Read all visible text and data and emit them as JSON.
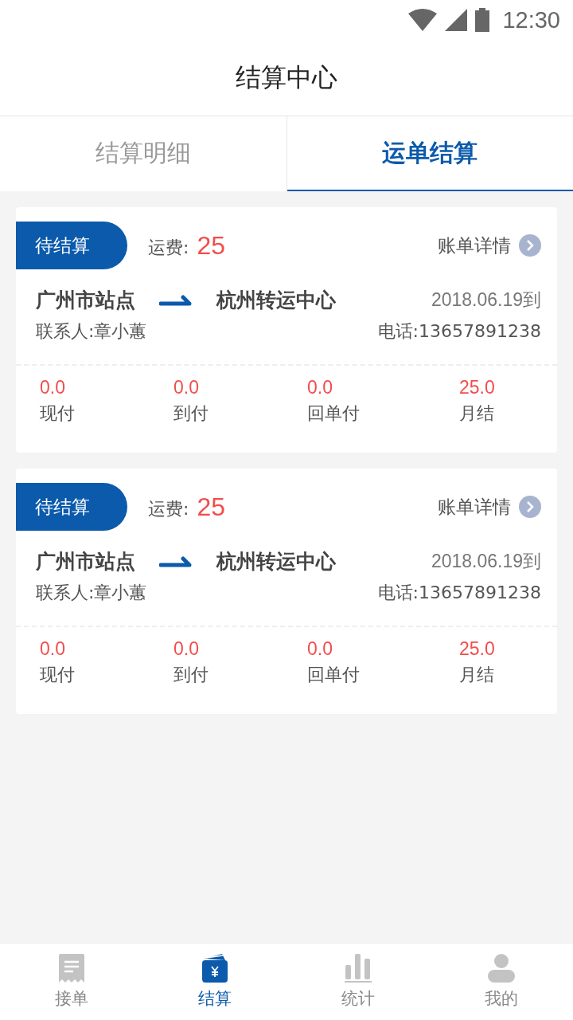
{
  "status_bar": {
    "time": "12:30"
  },
  "header": {
    "title": "结算中心"
  },
  "tabs": [
    {
      "label": "结算明细",
      "selected": false
    },
    {
      "label": "运单结算",
      "selected": true
    }
  ],
  "orders": [
    {
      "status": "待结算",
      "fee_label": "运费:",
      "fee": "25",
      "detail_link": "账单详情",
      "from": "广州市站点",
      "to": "杭州转运中心",
      "date": "2018.06.19到",
      "contact": "联系人:章小蕙",
      "phone": "电话:13657891238",
      "amounts": [
        {
          "value": "0.0",
          "label": "现付"
        },
        {
          "value": "0.0",
          "label": "到付"
        },
        {
          "value": "0.0",
          "label": "回单付"
        },
        {
          "value": "25.0",
          "label": "月结"
        }
      ]
    },
    {
      "status": "待结算",
      "fee_label": "运费:",
      "fee": "25",
      "detail_link": "账单详情",
      "from": "广州市站点",
      "to": "杭州转运中心",
      "date": "2018.06.19到",
      "contact": "联系人:章小蕙",
      "phone": "电话:13657891238",
      "amounts": [
        {
          "value": "0.0",
          "label": "现付"
        },
        {
          "value": "0.0",
          "label": "到付"
        },
        {
          "value": "0.0",
          "label": "回单付"
        },
        {
          "value": "25.0",
          "label": "月结"
        }
      ]
    }
  ],
  "bottom_nav": [
    {
      "kind": "receipt",
      "label": "接单",
      "selected": false
    },
    {
      "kind": "wallet",
      "label": "结算",
      "selected": true
    },
    {
      "kind": "chart",
      "label": "统计",
      "selected": false
    },
    {
      "kind": "person",
      "label": "我的",
      "selected": false
    }
  ]
}
